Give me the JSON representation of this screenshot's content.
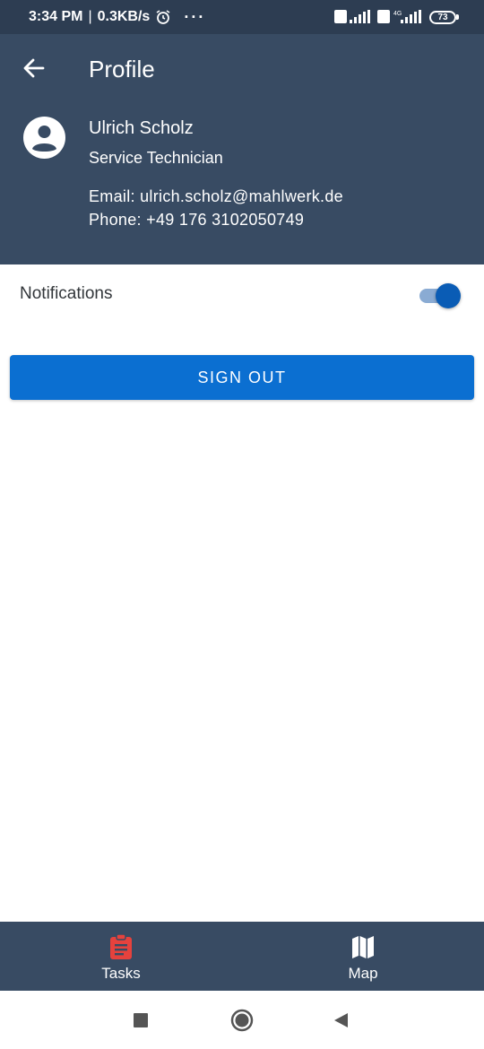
{
  "status_bar": {
    "time": "3:34 PM",
    "separator": "|",
    "net_speed": "0.3KB/s",
    "more": "···",
    "net_type": "4G",
    "battery": "73"
  },
  "header": {
    "title": "Profile",
    "user": {
      "name": "Ulrich Scholz",
      "role": "Service Technician",
      "email_line": "Email: ulrich.scholz@mahlwerk.de",
      "phone_line": "Phone: +49 176 3102050749"
    }
  },
  "notifications": {
    "label": "Notifications",
    "enabled": true
  },
  "sign_out_label": "SIGN OUT",
  "bottom_nav": {
    "tasks": {
      "label": "Tasks",
      "icon": "clipboard-icon",
      "color": "#e5423d"
    },
    "map": {
      "label": "Map",
      "icon": "map-icon",
      "color": "#ffffff"
    }
  },
  "colors": {
    "header_bg": "#384b63",
    "accent": "#0b6fd1",
    "toggle_thumb": "#0a5cb5"
  }
}
